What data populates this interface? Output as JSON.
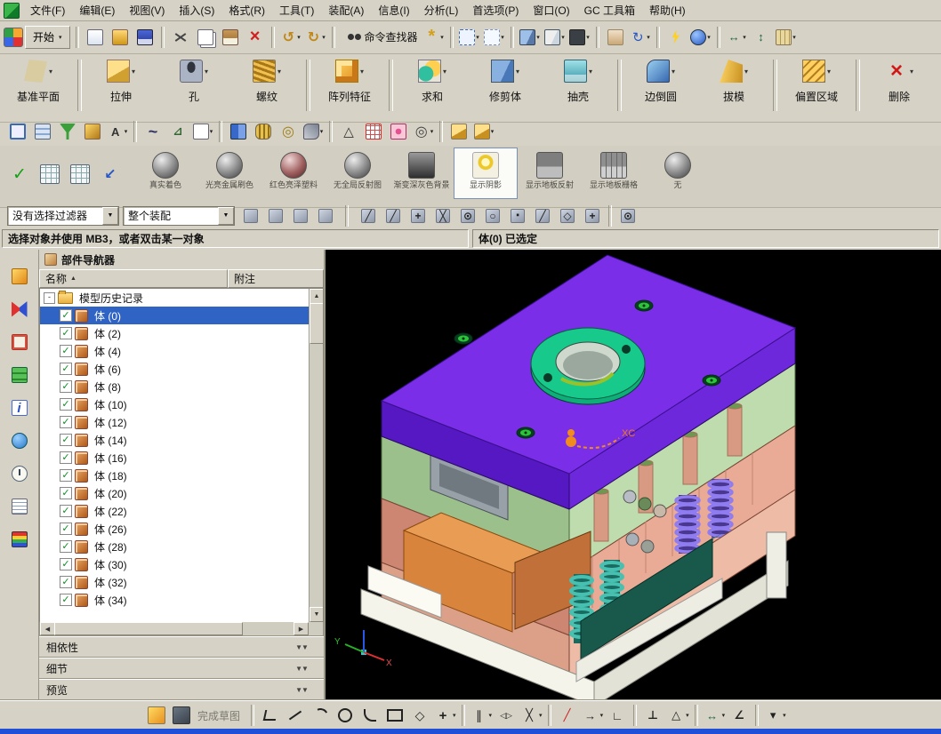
{
  "menubar": [
    "文件(F)",
    "编辑(E)",
    "视图(V)",
    "插入(S)",
    "格式(R)",
    "工具(T)",
    "装配(A)",
    "信息(I)",
    "分析(L)",
    "首选项(P)",
    "窗口(O)",
    "GC 工具箱",
    "帮助(H)"
  ],
  "toolbars": {
    "start_label": "开始",
    "command_finder": "命令查找器",
    "row2a": [
      "|",
      "new-file-icon",
      "open-file-icon",
      "save-icon",
      "|",
      "cut-icon",
      "copy-icon",
      "paste-icon",
      "delete-icon",
      "|",
      "undo-icon*",
      "redo-icon*",
      "|",
      "command-finder-icon"
    ],
    "row2b": [
      "sparkle-icon*",
      "|",
      "fit-view-icon*",
      "dashed-rect-icon*",
      "|",
      "shaded-cube-icon*",
      "wireframe-cube-icon*",
      "dark-cube-icon*",
      "|",
      "pan-hand-icon",
      "rotate-view-icon*",
      "|",
      "lightning-icon",
      "blue-gear-icon*",
      "|",
      "datum-dimension-icon*",
      "vertical-dimension-icon",
      "ruler-icon*"
    ],
    "row3": [
      "move-face-icon",
      "layer-settings-icon",
      "visibility-icon",
      "pen-icon",
      "abc-annotation-icon*",
      "|",
      "spline-icon",
      "measure-icon",
      "sheet-icon*",
      "|",
      "book-icon",
      "spring-icon",
      "washer-icon",
      "clip-icon*",
      "|",
      "triangle-icon",
      "red-grid-icon",
      "flower-pattern-icon",
      "rings-icon*",
      "|",
      "gold-block-icon",
      "gold-block2-icon*"
    ],
    "render_left": [
      "green-check-icon",
      "matrix-grid-icon",
      "matrix-grid2-icon",
      "nav-back-icon"
    ],
    "left_strip": [
      "assembly-navigator-icon",
      "constraint-navigator-icon",
      "part-navigator-icon",
      "reuse-library-icon",
      "info-icon",
      "browser-icon",
      "history-icon",
      "notes-icon",
      "palette-icon"
    ],
    "selection_pre": [
      "highlight-selection-icon",
      "select-through-icon",
      "magnify-cursor-icon",
      "snap-point-toggle-icon"
    ],
    "snap_points": [
      "snap-endpoint-icon",
      "snap-midpoint-icon",
      "snap-control-point-icon",
      "snap-intersection-icon",
      "snap-arc-center-icon",
      "snap-quadrant-icon",
      "snap-existing-point-icon",
      "snap-point-on-curve-icon",
      "snap-point-on-face-icon",
      "snap-grid-point-icon",
      "|",
      "snap-point-dialog-icon"
    ],
    "sketch_pre": [
      "finish-sketch-icon",
      "sketch-shade-icon"
    ],
    "sketch_tools": [
      "|",
      "profile-icon",
      "line-icon",
      "arc-icon",
      "circle-icon",
      "fillet-icon",
      "rectangle-icon",
      "polygon-icon",
      "point-icon*",
      "|",
      "offset-curve-icon*",
      "mirror-curve-icon",
      "intersection-curve-icon*",
      "|",
      "quick-trim-icon",
      "quick-extend-icon*",
      "make-corner-icon",
      "|",
      "geometric-constraints-icon",
      "auto-constrain-icon*",
      "|",
      "rapid-dimension-icon*",
      "angle-dimension-icon",
      "|",
      "more-sketch-tools-icon*"
    ]
  },
  "feature_toolbar": {
    "items": [
      {
        "label": "基准平面",
        "icon": "datum-plane-icon"
      },
      {
        "sep": true
      },
      {
        "label": "拉伸",
        "icon": "extrude-icon"
      },
      {
        "label": "孔",
        "icon": "hole-icon"
      },
      {
        "label": "螺纹",
        "icon": "thread-icon"
      },
      {
        "sep": true
      },
      {
        "label": "阵列特征",
        "icon": "pattern-feature-icon"
      },
      {
        "sep": true
      },
      {
        "label": "求和",
        "icon": "unite-icon"
      },
      {
        "label": "修剪体",
        "icon": "trim-body-icon"
      },
      {
        "label": "抽壳",
        "icon": "shell-icon"
      },
      {
        "sep": true
      },
      {
        "label": "边倒圆",
        "icon": "edge-blend-icon"
      },
      {
        "label": "拔模",
        "icon": "draft-icon"
      },
      {
        "sep": true
      },
      {
        "label": "偏置区域",
        "icon": "offset-region-icon"
      },
      {
        "sep": true
      },
      {
        "label": "删除",
        "icon": "delete-face-icon"
      }
    ]
  },
  "render_toolbar": {
    "items": [
      {
        "label": "真实着色",
        "icon": "true-shading-sphere-icon"
      },
      {
        "label": "光亮金属刷色",
        "icon": "brushed-metal-sphere-icon"
      },
      {
        "label": "红色亮泽塑料",
        "icon": "red-plastic-sphere-icon"
      },
      {
        "label": "无全局反射图",
        "icon": "no-reflection-sphere-icon"
      },
      {
        "label": "渐变深灰色背景",
        "icon": "gradient-background-icon"
      },
      {
        "label": "显示阴影",
        "icon": "show-shadow-bulb-icon",
        "selected": true
      },
      {
        "label": "显示地板反射",
        "icon": "floor-reflection-icon"
      },
      {
        "label": "显示地板栅格",
        "icon": "floor-grid-icon"
      },
      {
        "label": "无",
        "icon": "no-style-sphere-icon"
      }
    ]
  },
  "selection_bar": {
    "filter_value": "没有选择过滤器",
    "scope_value": "整个装配"
  },
  "status_bar": {
    "prompt": "选择对象并使用 MB3，或者双击某一对象",
    "selection_status": "体(0) 已选定"
  },
  "navigator": {
    "title": "部件导航器",
    "columns": {
      "name": "名称",
      "note": "附注"
    },
    "root_label": "模型历史记录",
    "items": [
      {
        "label": "体 (0)",
        "selected": true
      },
      {
        "label": "体 (2)"
      },
      {
        "label": "体 (4)"
      },
      {
        "label": "体 (6)"
      },
      {
        "label": "体 (8)"
      },
      {
        "label": "体 (10)"
      },
      {
        "label": "体 (12)"
      },
      {
        "label": "体 (14)"
      },
      {
        "label": "体 (16)"
      },
      {
        "label": "体 (18)"
      },
      {
        "label": "体 (20)"
      },
      {
        "label": "体 (22)"
      },
      {
        "label": "体 (26)"
      },
      {
        "label": "体 (28)"
      },
      {
        "label": "体 (30)"
      },
      {
        "label": "体 (32)"
      },
      {
        "label": "体 (34)"
      }
    ],
    "sections": [
      "相依性",
      "细节",
      "预览"
    ]
  },
  "sketch_bar": {
    "finish_sketch_label": "完成草图"
  },
  "viewport": {
    "wcs_x_label": "XC",
    "axis_x_label": "X",
    "axis_y_label": "Y"
  }
}
